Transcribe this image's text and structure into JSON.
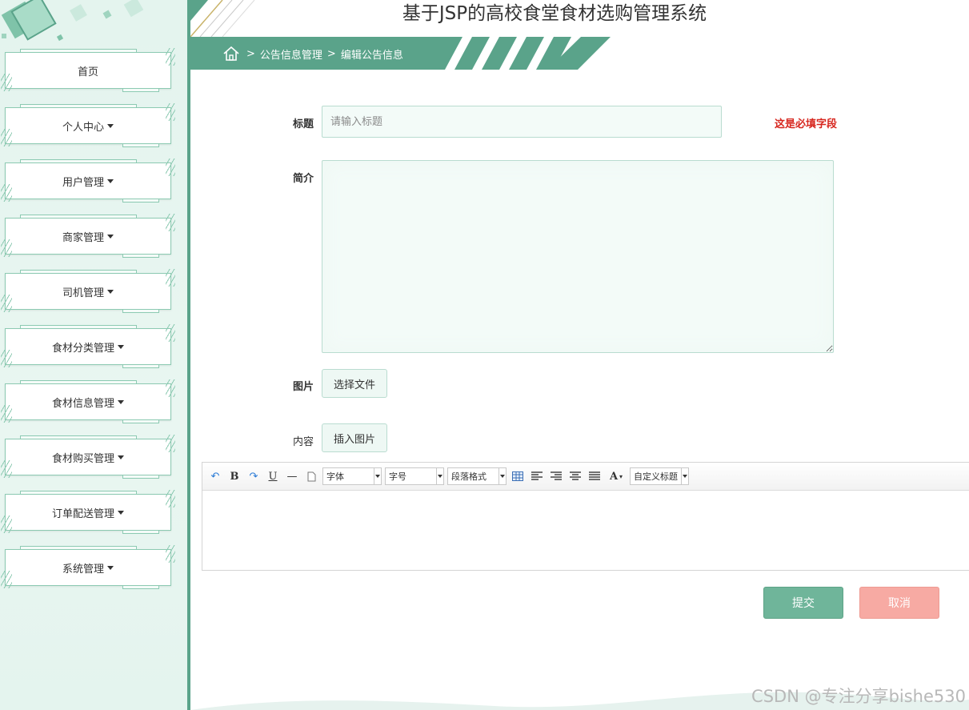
{
  "app": {
    "title": "基于JSP的高校食堂食材选购管理系统"
  },
  "breadcrumb": {
    "items": [
      "公告信息管理",
      "编辑公告信息"
    ],
    "separator": ">"
  },
  "sidebar": {
    "items": [
      {
        "label": "首页",
        "has_dropdown": false
      },
      {
        "label": "个人中心",
        "has_dropdown": true
      },
      {
        "label": "用户管理",
        "has_dropdown": true
      },
      {
        "label": "商家管理",
        "has_dropdown": true
      },
      {
        "label": "司机管理",
        "has_dropdown": true
      },
      {
        "label": "食材分类管理",
        "has_dropdown": true
      },
      {
        "label": "食材信息管理",
        "has_dropdown": true
      },
      {
        "label": "食材购买管理",
        "has_dropdown": true
      },
      {
        "label": "订单配送管理",
        "has_dropdown": true
      },
      {
        "label": "系统管理",
        "has_dropdown": true
      }
    ]
  },
  "form": {
    "title_label": "标题",
    "title_value": "",
    "title_placeholder": "请输入标题",
    "required_message": "这是必填字段",
    "intro_label": "简介",
    "intro_value": "",
    "image_label": "图片",
    "choose_file_label": "选择文件",
    "content_label": "内容",
    "insert_image_label": "插入图片"
  },
  "editor": {
    "font_select": "字体",
    "size_select": "字号",
    "paragraph_select": "段落格式",
    "custom_heading_select": "自定义标题",
    "content": ""
  },
  "actions": {
    "submit_label": "提交",
    "cancel_label": "取消"
  },
  "watermark": "CSDN @专注分享bishe530",
  "colors": {
    "accent": "#5aa38a",
    "sidebar_bg": "#e4f4ee",
    "required": "#d7261e",
    "submit": "#6fb59a",
    "cancel": "#f7aaa3"
  }
}
